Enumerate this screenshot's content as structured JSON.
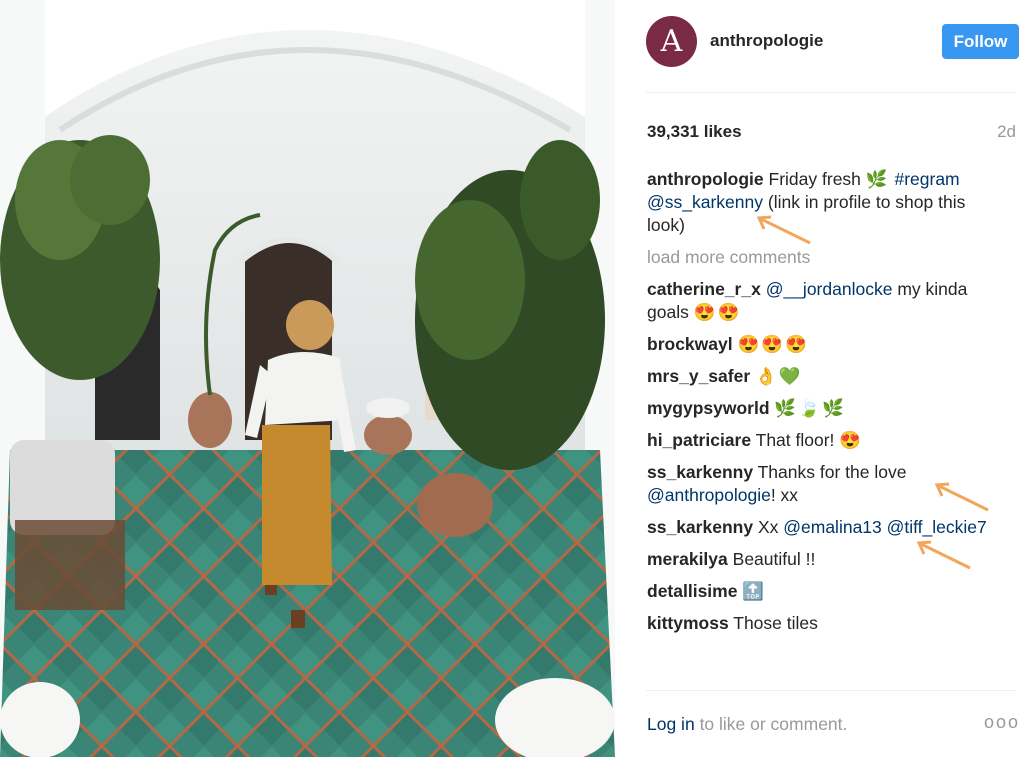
{
  "post": {
    "account": {
      "avatar_letter": "A",
      "username": "anthropologie",
      "follow_label": "Follow"
    },
    "likes": "39,331 likes",
    "time": "2d",
    "caption": {
      "username": "anthropologie",
      "text_before": "Friday fresh",
      "emoji": "🌿",
      "hashtag": "#regram",
      "mention": "@ss_karkenny",
      "text_after": "(link in profile to shop this look)"
    },
    "load_more": "load more comments",
    "comments": [
      {
        "username": "catherine_r_x",
        "mention": "@__jordanlocke",
        "text": "my kinda goals",
        "emoji": "😍😍"
      },
      {
        "username": "brockwayl",
        "mention": "",
        "text": "",
        "emoji": "😍😍😍"
      },
      {
        "username": "mrs_y_safer",
        "mention": "",
        "text": "",
        "emoji": "👌💚"
      },
      {
        "username": "mygypsyworld",
        "mention": "",
        "text": "",
        "emoji": "🌿🍃🌿"
      },
      {
        "username": "hi_patriciare",
        "mention": "",
        "text": "That floor!",
        "emoji": "😍"
      },
      {
        "username": "ss_karkenny",
        "mention": "",
        "text": "Thanks for the love",
        "mention2": "@anthropologie",
        "text2": "! xx",
        "emoji": ""
      },
      {
        "username": "ss_karkenny",
        "mention": "",
        "text": "Xx",
        "mention2": "@emalina13 @tiff_leckie7",
        "text2": "",
        "emoji": ""
      },
      {
        "username": "merakilya",
        "mention": "",
        "text": "Beautiful !!",
        "emoji": ""
      },
      {
        "username": "detallisime",
        "mention": "",
        "text": "",
        "emoji": "🔝"
      },
      {
        "username": "kittymoss",
        "mention": "",
        "text": "Those tiles",
        "emoji": ""
      }
    ],
    "footer": {
      "login": "Log in",
      "text": "to like or comment.",
      "more": "ooo"
    }
  },
  "colors": {
    "follow_button": "#3897f0",
    "link": "#003569",
    "muted": "#999999",
    "arrow": "#f2a65a",
    "tile_green": "#3f8a7a",
    "tile_terracotta": "#b86a45"
  }
}
